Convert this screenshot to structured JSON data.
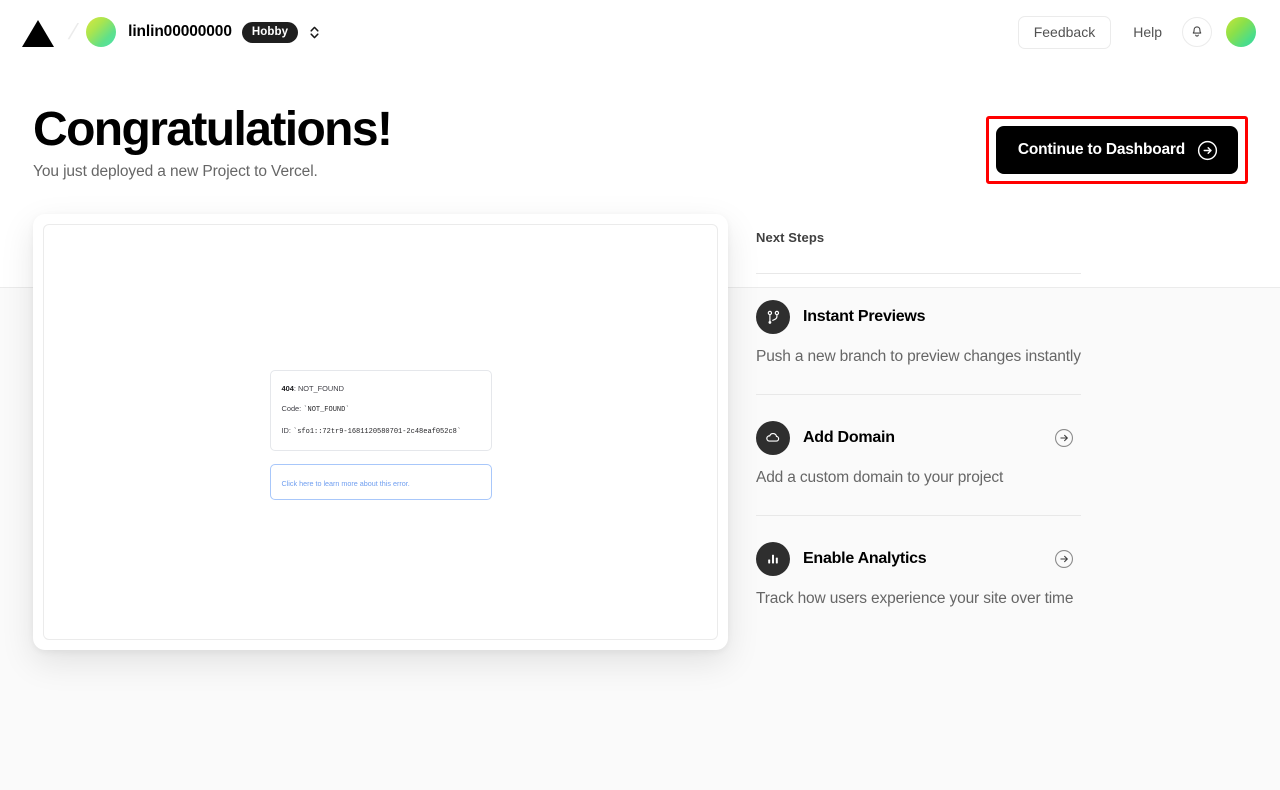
{
  "header": {
    "logo_icon": "vercel-triangle-logo",
    "breadcrumb_separator": "/",
    "team_avatar_icon": "team-avatar-gradient",
    "team_name": "linlin00000000",
    "plan_badge": "Hobby",
    "selector_icon": "chevron-up-down-icon",
    "feedback_label": "Feedback",
    "help_label": "Help",
    "notifications_icon": "bell-icon",
    "user_avatar_icon": "user-avatar-gradient"
  },
  "hero": {
    "title": "Congratulations!",
    "subtitle": "You just deployed a new Project to Vercel.",
    "cta_label": "Continue to Dashboard",
    "cta_icon": "arrow-right-circle-icon",
    "annotation_color": "#ff0000"
  },
  "preview": {
    "error_status": "404",
    "error_status_suffix": ": NOT_FOUND",
    "error_code_label": "Code:",
    "error_code_value": "`NOT_FOUND`",
    "error_id_label": "ID:",
    "error_id_value": "`sfo1::72tr9-1681120580701-2c48eaf052c8`",
    "error_link": "Click here to learn more about this error.",
    "link_color": "#6f9ef0"
  },
  "next_steps": {
    "title": "Next Steps",
    "items": [
      {
        "icon": "git-branch-icon",
        "label": "Instant Previews",
        "description": "Push a new branch to preview changes instantly",
        "has_arrow": false,
        "arrow_icon": ""
      },
      {
        "icon": "cloud-icon",
        "label": "Add Domain",
        "description": "Add a custom domain to your project",
        "has_arrow": true,
        "arrow_icon": "arrow-right-circle-icon"
      },
      {
        "icon": "bar-chart-icon",
        "label": "Enable Analytics",
        "description": "Track how users experience your site over time",
        "has_arrow": true,
        "arrow_icon": "arrow-right-circle-icon"
      }
    ]
  }
}
